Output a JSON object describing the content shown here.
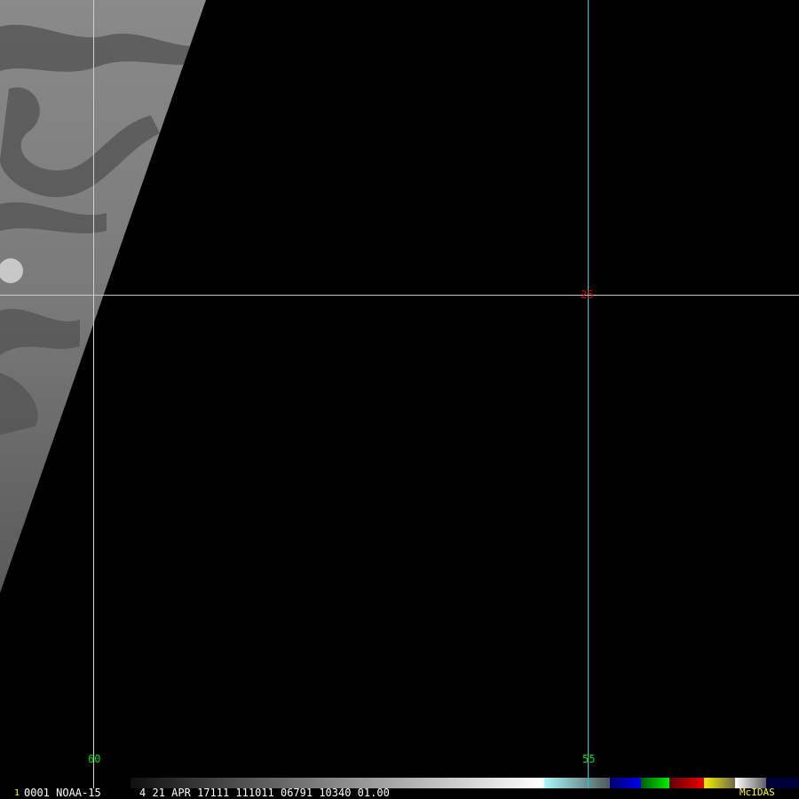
{
  "frame_number": "1",
  "info_line": "0001 NOAA-15      4 21 APR 17111 111011 06791 10340 01.00",
  "brand": "McIDAS",
  "gridlines": {
    "longitude_labels": [
      "60",
      "55"
    ],
    "latitude_labels": [
      "25"
    ]
  },
  "colors": {
    "lat_line": "#c8c8c8",
    "lon_line_55": "#00d8e8",
    "lon_label": "#00e000",
    "lat_label": "#e00000",
    "brand": "#ffff00",
    "frame_number": "#ffff00"
  },
  "colorbar_segments": [
    "#0a0a0a",
    "#ffffff",
    "#a8f8f8",
    "#505858",
    "#000070",
    "#0000f0",
    "#006000",
    "#00f000",
    "#600000",
    "#f00000",
    "#f0f000",
    "#706850",
    "#ffffff",
    "#606060",
    "#000030",
    "#000050"
  ]
}
